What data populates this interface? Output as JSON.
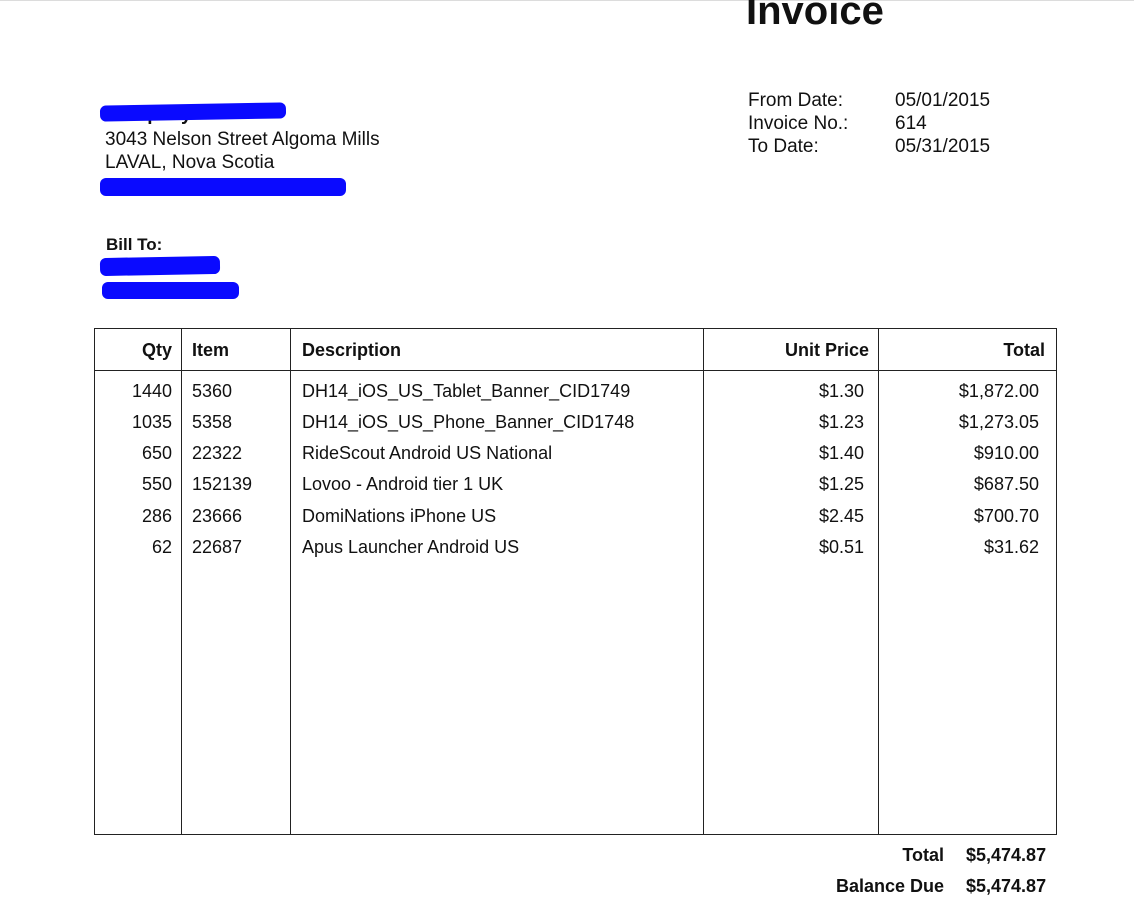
{
  "document": {
    "title": "Invoice"
  },
  "company": {
    "name": "Company",
    "address_line1": "3043 Nelson Street Algoma Mills",
    "address_line2": "LAVAL, Nova Scotia"
  },
  "meta": {
    "from_date_label": "From Date:",
    "from_date_value": "05/01/2015",
    "invoice_no_label": "Invoice No.:",
    "invoice_no_value": "614",
    "to_date_label": "To Date:",
    "to_date_value": "05/31/2015"
  },
  "bill_to": {
    "label": "Bill To:"
  },
  "redaction_color": "#0a0aff",
  "table": {
    "headers": {
      "qty": "Qty",
      "item": "Item",
      "description": "Description",
      "unit_price": "Unit Price",
      "total": "Total"
    },
    "rows": [
      {
        "qty": "1440",
        "item": "5360",
        "description": "DH14_iOS_US_Tablet_Banner_CID1749",
        "unit_price": "$1.30",
        "total": "$1,872.00"
      },
      {
        "qty": "1035",
        "item": "5358",
        "description": "DH14_iOS_US_Phone_Banner_CID1748",
        "unit_price": "$1.23",
        "total": "$1,273.05"
      },
      {
        "qty": "650",
        "item": "22322",
        "description": "RideScout Android US National",
        "unit_price": "$1.40",
        "total": "$910.00"
      },
      {
        "qty": "550",
        "item": "152139",
        "description": "Lovoo - Android tier 1 UK",
        "unit_price": "$1.25",
        "total": "$687.50"
      },
      {
        "qty": "286",
        "item": "23666",
        "description": "DomiNations iPhone US",
        "unit_price": "$2.45",
        "total": "$700.70"
      },
      {
        "qty": "62",
        "item": "22687",
        "description": "Apus Launcher Android US",
        "unit_price": "$0.51",
        "total": "$31.62"
      }
    ]
  },
  "totals": {
    "total_label": "Total",
    "total_value": "$5,474.87",
    "balance_due_label": "Balance Due",
    "balance_due_value": "$5,474.87"
  }
}
